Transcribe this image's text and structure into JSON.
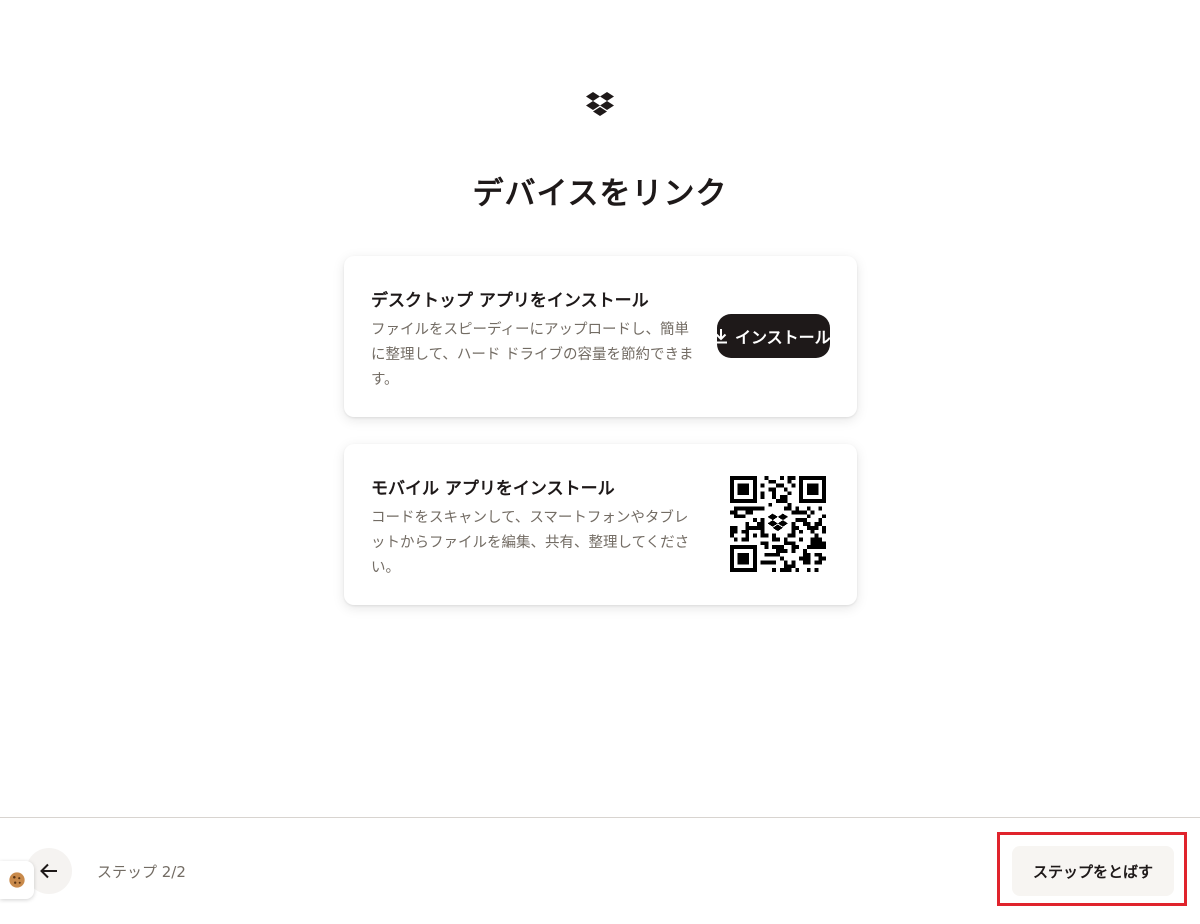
{
  "page": {
    "title": "デバイスをリンク"
  },
  "desktop_card": {
    "title": "デスクトップ アプリをインストール",
    "description": "ファイルをスピーディーにアップロードし、簡単に整理して、ハード ドライブの容量を節約できます。",
    "install_label": "インストール",
    "icon": "download-icon"
  },
  "mobile_card": {
    "title": "モバイル アプリをインストール",
    "description": "コードをスキャンして、スマートフォンやタブレットからファイルを編集、共有、整理してください。",
    "qr_icon": "qr-code"
  },
  "footer": {
    "step_label": "ステップ 2/2",
    "skip_label": "ステップをとばす",
    "back_icon": "arrow-left-icon",
    "cookie_icon": "cookie-icon"
  },
  "colors": {
    "primary_dark": "#1e1919",
    "muted_text": "#736c64",
    "highlight": "#e0232c"
  }
}
